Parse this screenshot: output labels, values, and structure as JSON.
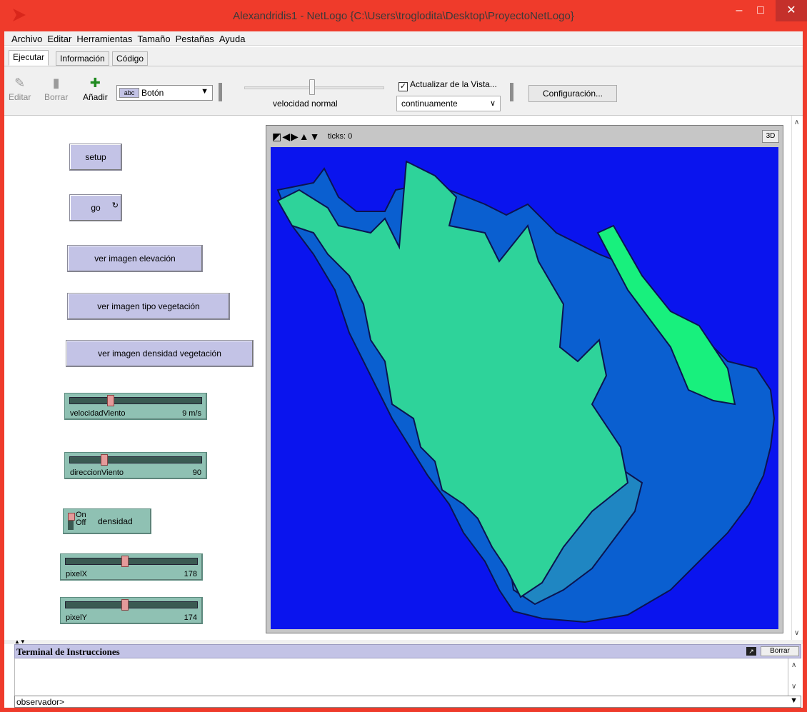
{
  "window": {
    "title": "Alexandridis1 - NetLogo {C:\\Users\\troglodita\\Desktop\\ProyectoNetLogo}",
    "minimize": "–",
    "maximize": "□",
    "close": "✕"
  },
  "menu": [
    "Archivo",
    "Editar",
    "Herramientas",
    "Tamaño",
    "Pestañas",
    "Ayuda"
  ],
  "tabs": [
    {
      "label": "Ejecutar",
      "active": true
    },
    {
      "label": "Información",
      "active": false
    },
    {
      "label": "Código",
      "active": false
    }
  ],
  "toolbar": {
    "edit_label": "Editar",
    "delete_label": "Borrar",
    "add_label": "Añadir",
    "widget_type_chip": "abc",
    "widget_type": "Botón",
    "speed_label": "velocidad normal",
    "speed_fraction": 0.48,
    "update_view_label": "Actualizar de la Vista...",
    "update_view_checked": true,
    "update_mode": "continuamente",
    "settings_label": "Configuración..."
  },
  "buttons": {
    "setup": "setup",
    "go": "go",
    "ver_elevacion": "ver imagen elevación",
    "ver_tipo_vegetacion": "ver imagen tipo vegetación",
    "ver_densidad_vegetacion": "ver imagen densidad vegetación"
  },
  "sliders": {
    "velocidadViento": {
      "name": "velocidadViento",
      "value": "9 m/s",
      "fraction": 0.3
    },
    "direccionViento": {
      "name": "direccionViento",
      "value": "90",
      "fraction": 0.25
    },
    "pixelX": {
      "name": "pixelX",
      "value": "178",
      "fraction": 0.45
    },
    "pixelY": {
      "name": "pixelY",
      "value": "174",
      "fraction": 0.45
    }
  },
  "switch": {
    "on": "On",
    "off": "Off",
    "name": "densidad",
    "state": "off"
  },
  "view": {
    "ticks": "ticks: 0",
    "btn_3d": "3D",
    "colors": {
      "background": "#0a14ee",
      "class_dark": "#0a5fd0",
      "class_mid": "#1f86c2",
      "class_light": "#2ed39a",
      "class_bright": "#18f07d"
    }
  },
  "command_center": {
    "title": "Terminal de Instrucciones",
    "clear_label": "Borrar",
    "context": "observador>",
    "input_value": ""
  }
}
